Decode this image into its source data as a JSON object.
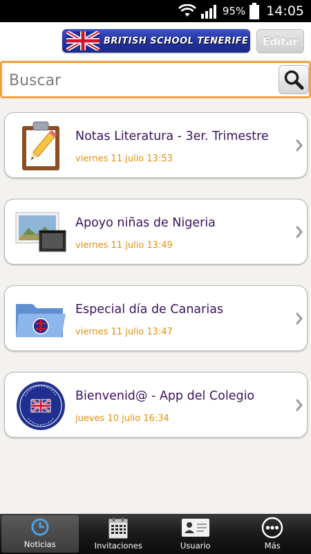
{
  "status_bar": {
    "battery_percent": "95%",
    "time": "14:05",
    "icons": [
      "wifi-icon",
      "signal-icon",
      "battery-icon"
    ]
  },
  "header": {
    "logo_text": "BRITISH SCHOOL TENERIFE",
    "edit_label": "Editar"
  },
  "search": {
    "placeholder": "Buscar",
    "value": ""
  },
  "news": [
    {
      "title": "Notas Literatura - 3er. Trimestre",
      "date": "viernes 11 julio 13:53",
      "icon": "clipboard-pencil-icon"
    },
    {
      "title": "Apoyo niñas de Nigeria",
      "date": "viernes 11 julio 13:49",
      "icon": "photos-icon"
    },
    {
      "title": "Especial día de Canarias",
      "date": "viernes 11 julio 13:47",
      "icon": "folder-icon"
    },
    {
      "title": "Bienvenid@ - App del Colegio",
      "date": "jueves 10 julio 16:34",
      "icon": "school-crest-icon"
    }
  ],
  "tabs": [
    {
      "label": "Noticias",
      "icon": "clock-icon",
      "active": true
    },
    {
      "label": "Invitaciones",
      "icon": "calendar-icon",
      "active": false
    },
    {
      "label": "Usuario",
      "icon": "id-card-icon",
      "active": false
    },
    {
      "label": "Más",
      "icon": "more-icon",
      "active": false
    }
  ],
  "colors": {
    "accent_orange": "#f0a23c",
    "title_purple": "#3a1060",
    "date_orange": "#e2900e",
    "logo_blue": "#2232a0"
  }
}
